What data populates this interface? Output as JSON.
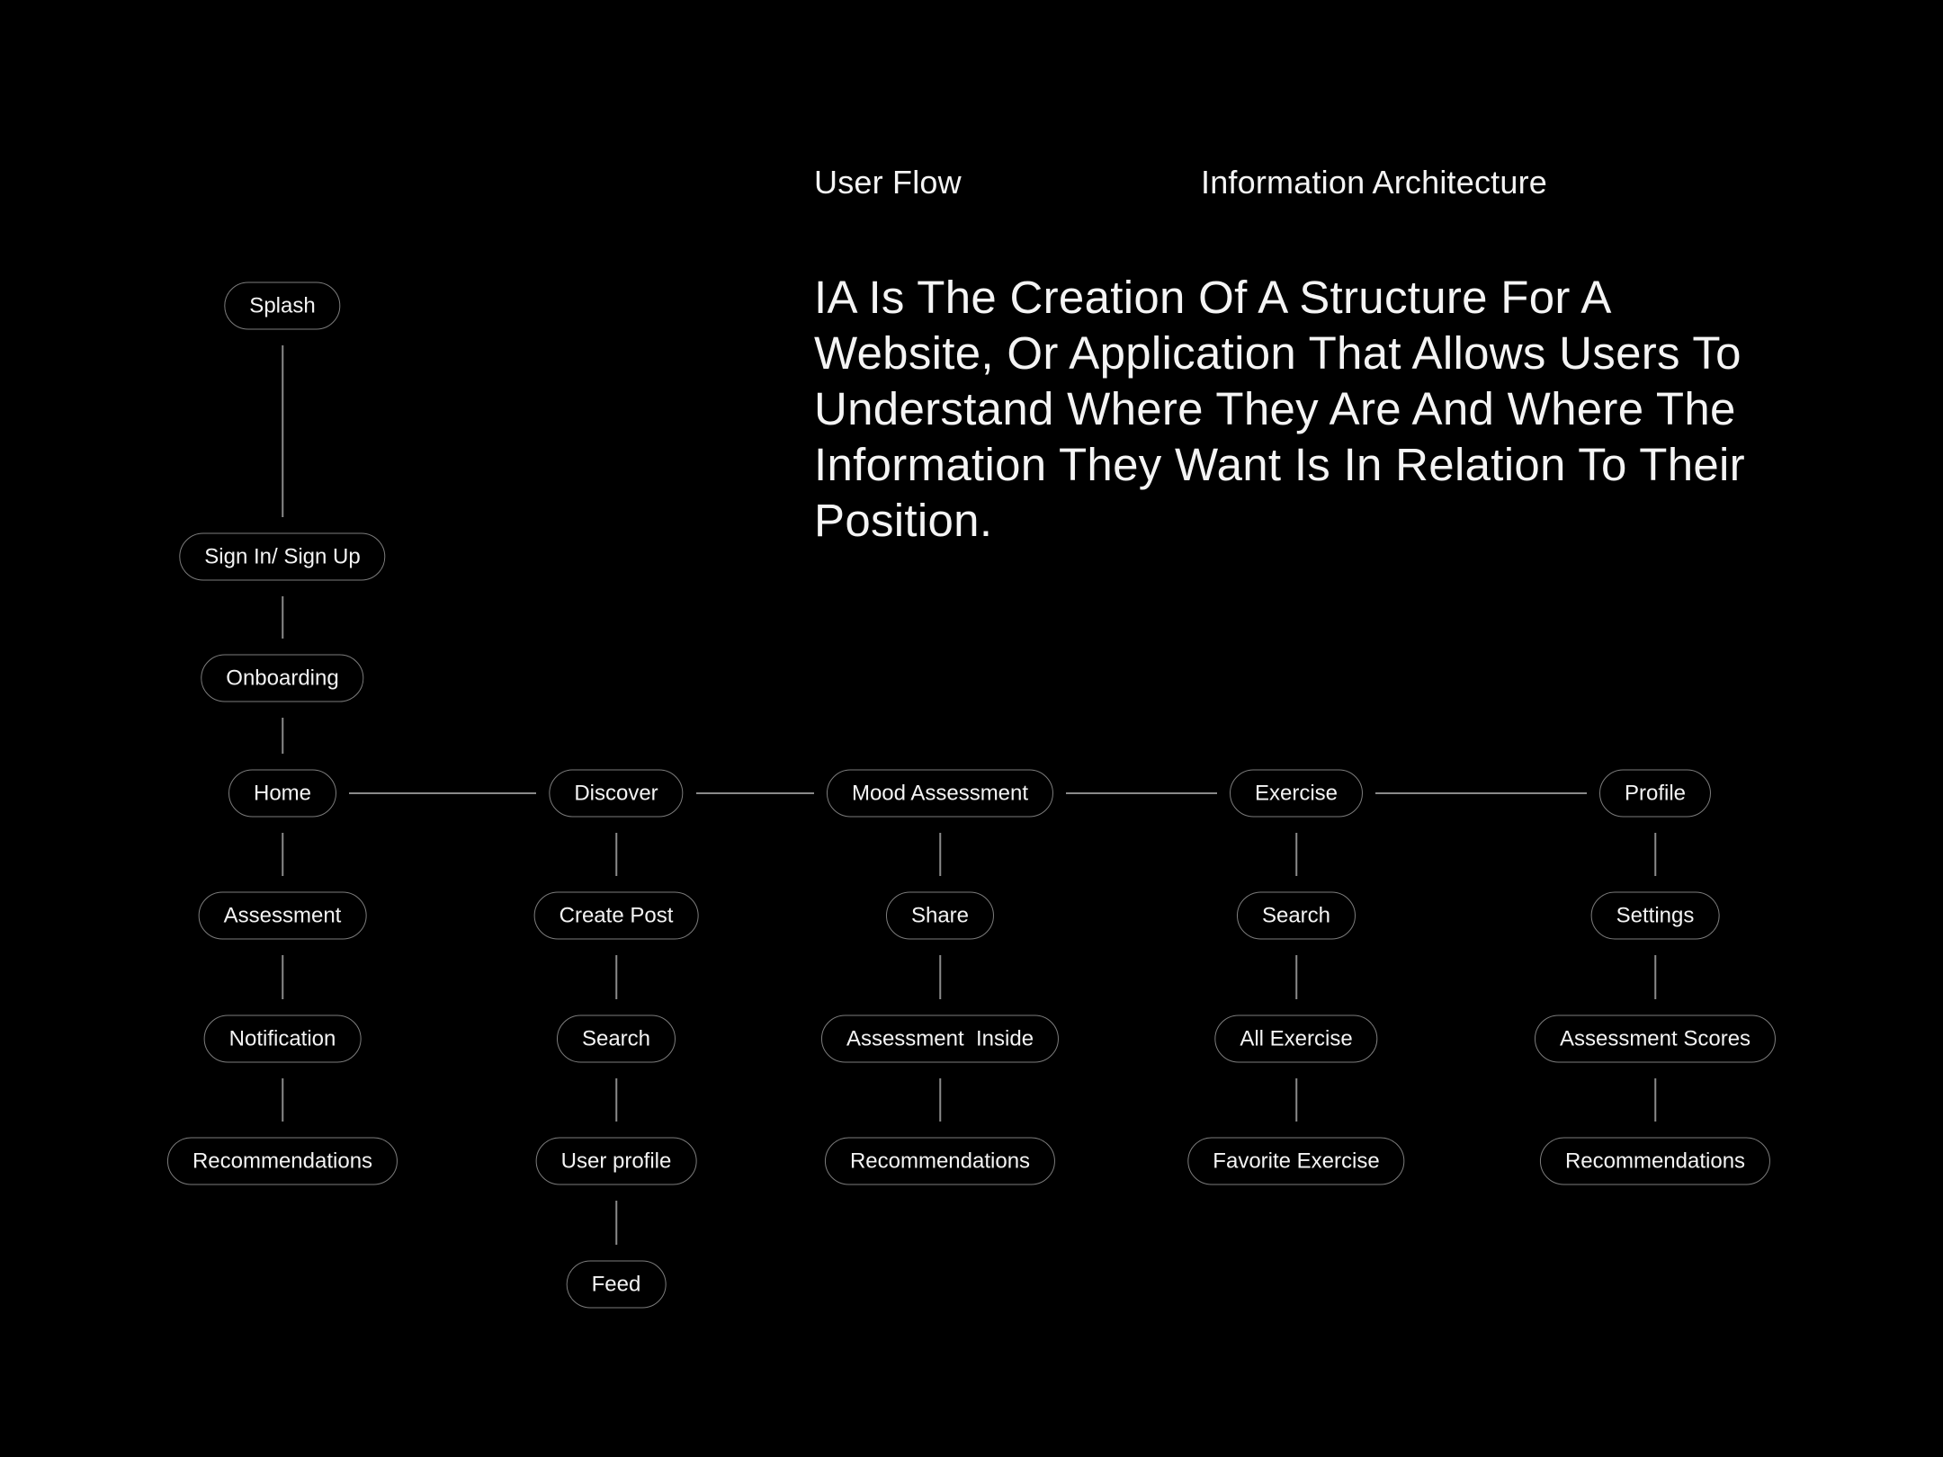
{
  "headings": {
    "user_flow": "User Flow",
    "information_architecture": "Information Architecture"
  },
  "description": {
    "lines": [
      "IA Is The Creation Of A Structure For A",
      "Website, Or Application That Allows Users To",
      "Understand Where They Are And Where The",
      "Information They Want Is In Relation To Their",
      "Position."
    ]
  },
  "flow": {
    "entry": [
      "Splash",
      "Sign In/ Sign Up",
      "Onboarding"
    ],
    "sections": [
      {
        "label": "Home",
        "children": [
          "Assessment",
          "Notification",
          "Recommendations"
        ]
      },
      {
        "label": "Discover",
        "children": [
          "Create Post",
          "Search",
          "User profile",
          "Feed"
        ]
      },
      {
        "label": "Mood Assessment",
        "children": [
          "Share",
          "Assessment  Inside",
          "Recommendations"
        ]
      },
      {
        "label": "Exercise",
        "children": [
          "Search",
          "All Exercise",
          "Favorite Exercise"
        ]
      },
      {
        "label": "Profile",
        "children": [
          "Settings",
          "Assessment Scores",
          "Recommendations"
        ]
      }
    ]
  },
  "colors": {
    "background": "#000000",
    "text": "#f4f4f4",
    "border": "#7c7c7c",
    "connector": "#8a8a8a"
  }
}
